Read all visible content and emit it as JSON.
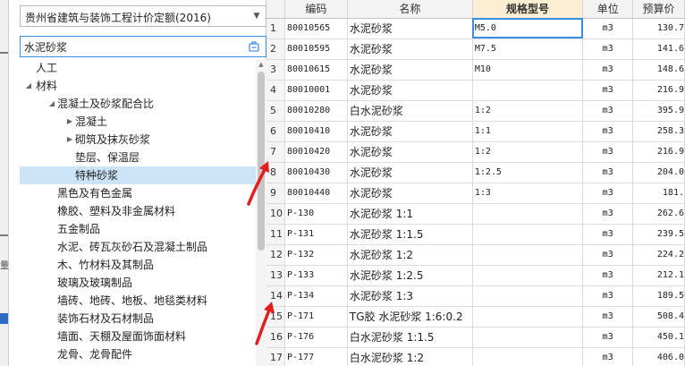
{
  "quota_selector": {
    "value": "贵州省建筑与装饰工程计价定额(2016)"
  },
  "search": {
    "value": "水泥砂浆"
  },
  "left_sliver": {
    "text": "量"
  },
  "tree": [
    {
      "label": "人工",
      "level": 1,
      "toggle": ""
    },
    {
      "label": "材料",
      "level": 1,
      "toggle": "expanded"
    },
    {
      "label": "混凝土及砂浆配合比",
      "level": 2,
      "toggle": "expanded"
    },
    {
      "label": "混凝土",
      "level": 3,
      "toggle": "collapsed"
    },
    {
      "label": "砌筑及抹灰砂浆",
      "level": 3,
      "toggle": "collapsed"
    },
    {
      "label": "垫层、保温层",
      "level": 3,
      "toggle": ""
    },
    {
      "label": "特种砂浆",
      "level": 3,
      "toggle": "",
      "selected": true
    },
    {
      "label": "黑色及有色金属",
      "level": 2,
      "toggle": ""
    },
    {
      "label": "橡胶、塑料及非金属材料",
      "level": 2,
      "toggle": ""
    },
    {
      "label": "五金制品",
      "level": 2,
      "toggle": ""
    },
    {
      "label": "水泥、砖瓦灰砂石及混凝土制品",
      "level": 2,
      "toggle": ""
    },
    {
      "label": "木、竹材料及其制品",
      "level": 2,
      "toggle": ""
    },
    {
      "label": "玻璃及玻璃制品",
      "level": 2,
      "toggle": ""
    },
    {
      "label": "墙砖、地砖、地板、地毯类材料",
      "level": 2,
      "toggle": ""
    },
    {
      "label": "装饰石材及石材制品",
      "level": 2,
      "toggle": ""
    },
    {
      "label": "墙面、天棚及屋面饰面材料",
      "level": 2,
      "toggle": ""
    },
    {
      "label": "龙骨、龙骨配件",
      "level": 2,
      "toggle": ""
    }
  ],
  "grid": {
    "headers": {
      "rownum": "",
      "code": "编码",
      "name": "名称",
      "spec": "规格型号",
      "unit": "单位",
      "price": "预算价"
    },
    "highlighted_header": "spec",
    "rows": [
      {
        "n": "1",
        "code": "80010565",
        "name": "水泥砂浆",
        "spec": "M5.0",
        "unit": "m3",
        "price": "130.7"
      },
      {
        "n": "2",
        "code": "80010595",
        "name": "水泥砂浆",
        "spec": "M7.5",
        "unit": "m3",
        "price": "141.6"
      },
      {
        "n": "3",
        "code": "80010615",
        "name": "水泥砂浆",
        "spec": "M10",
        "unit": "m3",
        "price": "148.6"
      },
      {
        "n": "4",
        "code": "80010001",
        "name": "水泥砂浆",
        "spec": "",
        "unit": "m3",
        "price": "216.9"
      },
      {
        "n": "5",
        "code": "80010280",
        "name": "白水泥砂浆",
        "spec": "1:2",
        "unit": "m3",
        "price": "395.9"
      },
      {
        "n": "6",
        "code": "80010410",
        "name": "水泥砂浆",
        "spec": "1:1",
        "unit": "m3",
        "price": "258.3"
      },
      {
        "n": "7",
        "code": "80010420",
        "name": "水泥砂浆",
        "spec": "1:2",
        "unit": "m3",
        "price": "216.9"
      },
      {
        "n": "8",
        "code": "80010430",
        "name": "水泥砂浆",
        "spec": "1:2.5",
        "unit": "m3",
        "price": "204.0"
      },
      {
        "n": "9",
        "code": "80010440",
        "name": "水泥砂浆",
        "spec": "1:3",
        "unit": "m3",
        "price": "181."
      },
      {
        "n": "10",
        "code": "P-130",
        "name": "水泥砂浆 1:1",
        "spec": "",
        "unit": "m3",
        "price": "262.6"
      },
      {
        "n": "11",
        "code": "P-131",
        "name": "水泥砂浆 1:1.5",
        "spec": "",
        "unit": "m3",
        "price": "239.5"
      },
      {
        "n": "12",
        "code": "P-132",
        "name": "水泥砂浆 1:2",
        "spec": "",
        "unit": "m3",
        "price": "224.2"
      },
      {
        "n": "13",
        "code": "P-133",
        "name": "水泥砂浆 1:2.5",
        "spec": "",
        "unit": "m3",
        "price": "212.1"
      },
      {
        "n": "14",
        "code": "P-134",
        "name": "水泥砂浆 1:3",
        "spec": "",
        "unit": "m3",
        "price": "189.5"
      },
      {
        "n": "15",
        "code": "P-171",
        "name": "TG胶 水泥砂浆 1:6:0.2",
        "spec": "",
        "unit": "m3",
        "price": "508.4"
      },
      {
        "n": "16",
        "code": "P-176",
        "name": "白水泥砂浆 1:1.5",
        "spec": "",
        "unit": "m3",
        "price": "450.1"
      },
      {
        "n": "17",
        "code": "P-177",
        "name": "白水泥砂浆 1:2",
        "spec": "",
        "unit": "m3",
        "price": "406.0"
      }
    ],
    "active_cell": {
      "row": 1,
      "column": "spec"
    }
  },
  "colors": {
    "selection": "#cce4f7",
    "header_highlight": "#fbeed2",
    "annotation_arrow": "#e02020",
    "active_border": "#3a8ee6"
  }
}
